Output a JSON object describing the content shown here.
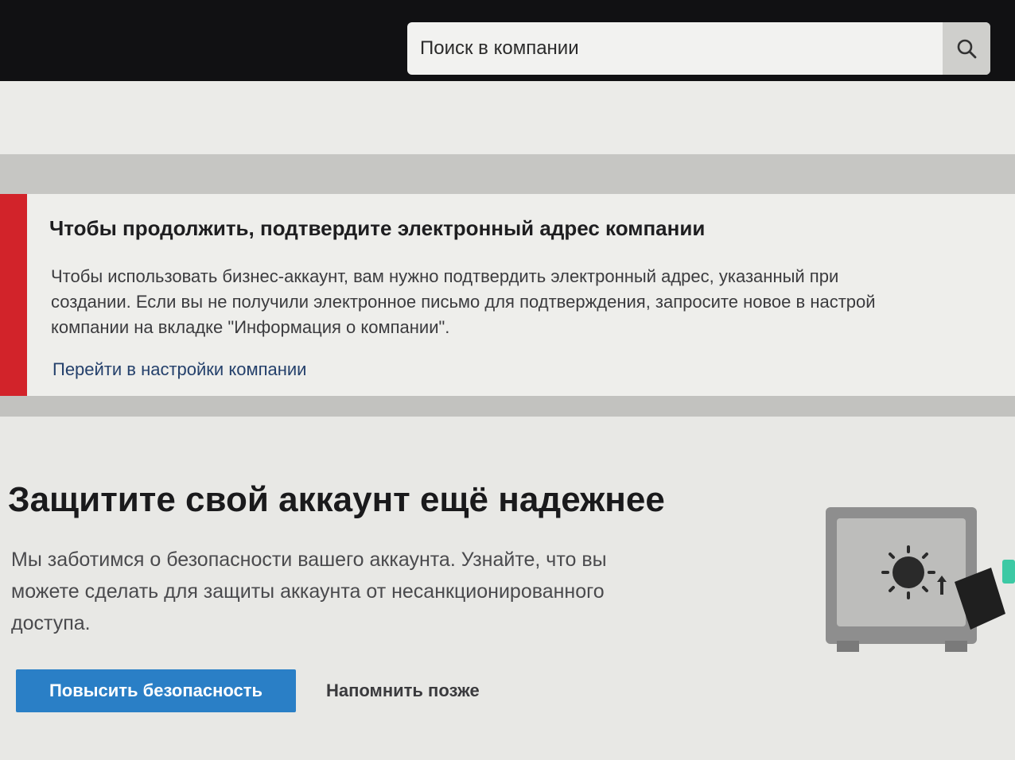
{
  "header": {
    "search": {
      "placeholder": "Поиск в компании"
    },
    "icons": {
      "search": "search-icon"
    }
  },
  "alert": {
    "title": "Чтобы продолжить, подтвердите электронный адрес компании",
    "text_lines": [
      "Чтобы использовать бизнес-аккаунт, вам нужно подтвердить электронный адрес, указанный при",
      "создании. Если вы не получили электронное письмо для подтверждения, запросите новое в настрой",
      "компании на вкладке \"Информация о компании\"."
    ],
    "link_label": "Перейти в настройки компании",
    "accent_color": "#d2232a"
  },
  "security": {
    "title": "Защитите свой аккаунт ещё надежнее",
    "text_lines": [
      "Мы заботимся о безопасности вашего аккаунта. Узнайте, что вы",
      "можете сделать для защиты аккаунта от несанкционированного",
      "доступа."
    ],
    "primary_button": "Повысить безопасность",
    "secondary_button": "Напомнить позже",
    "primary_color": "#2a7fc6",
    "illustration_icon": "safe-icon"
  }
}
